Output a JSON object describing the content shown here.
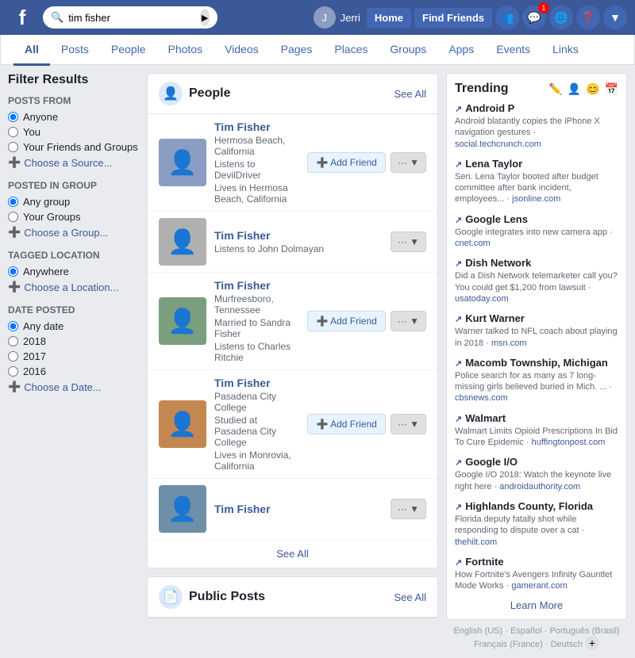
{
  "nav": {
    "logo": "f",
    "search_value": "tim fisher",
    "search_placeholder": "Search",
    "user_name": "Jerri",
    "notif_count": "1",
    "buttons": [
      "Home",
      "Find Friends"
    ],
    "icons": [
      "people-icon",
      "messages-icon",
      "globe-icon",
      "help-icon",
      "dropdown-icon"
    ]
  },
  "tabs": {
    "items": [
      {
        "label": "All",
        "active": true
      },
      {
        "label": "Posts",
        "active": false
      },
      {
        "label": "People",
        "active": false
      },
      {
        "label": "Photos",
        "active": false
      },
      {
        "label": "Videos",
        "active": false
      },
      {
        "label": "Pages",
        "active": false
      },
      {
        "label": "Places",
        "active": false
      },
      {
        "label": "Groups",
        "active": false
      },
      {
        "label": "Apps",
        "active": false
      },
      {
        "label": "Events",
        "active": false
      },
      {
        "label": "Links",
        "active": false
      }
    ]
  },
  "sidebar": {
    "title": "Filter Results",
    "posts_from": {
      "label": "POSTS FROM",
      "options": [
        "Anyone",
        "You",
        "Your Friends and Groups"
      ],
      "add_label": "Choose a Source..."
    },
    "posted_in_group": {
      "label": "POSTED IN GROUP",
      "options": [
        "Any group",
        "Your Groups"
      ],
      "add_label": "Choose a Group..."
    },
    "tagged_location": {
      "label": "TAGGED LOCATION",
      "options": [
        "Anywhere"
      ],
      "add_label": "Choose a Location..."
    },
    "date_posted": {
      "label": "DATE POSTED",
      "options": [
        "Any date",
        "2018",
        "2017",
        "2016"
      ],
      "add_label": "Choose a Date..."
    }
  },
  "people_section": {
    "title": "People",
    "see_all": "See All",
    "people": [
      {
        "name": "Tim Fisher",
        "details": [
          "Hermosa Beach, California",
          "Listens to DevilDriver",
          "Lives in Hermosa Beach, California"
        ],
        "has_add": true,
        "avatar_color": "#8b9dc3"
      },
      {
        "name": "Tim Fisher",
        "details": [
          "Listens to John Dolmayan"
        ],
        "has_add": false,
        "avatar_color": "#b0b0b0"
      },
      {
        "name": "Tim Fisher",
        "details": [
          "Murfreesboro, Tennessee",
          "Married to Sandra Fisher",
          "Listens to Charles Ritchie"
        ],
        "has_add": true,
        "avatar_color": "#7a9e7e"
      },
      {
        "name": "Tim Fisher",
        "details": [
          "Pasadena City College",
          "Studied at Pasadena City College",
          "Lives in Monrovia, California"
        ],
        "has_add": true,
        "avatar_color": "#c4874f"
      },
      {
        "name": "Tim Fisher",
        "details": [],
        "has_add": false,
        "avatar_color": "#6d8fa8"
      }
    ],
    "bottom_see_all": "See All",
    "add_friend_label": "Add Friend"
  },
  "public_posts": {
    "title": "Public Posts",
    "see_all": "See All"
  },
  "trending": {
    "title": "Trending",
    "items": [
      {
        "topic": "Android P",
        "desc": "Android blatantly copies the iPhone X navigation gestures",
        "source": "social.techcrunch.com"
      },
      {
        "topic": "Lena Taylor",
        "desc": "Sen. Lena Taylor booted after budget committee after bank incident, employees...",
        "source": "jsonline.com"
      },
      {
        "topic": "Google Lens",
        "desc": "Google integrates into new camera app",
        "source": "cnet.com"
      },
      {
        "topic": "Dish Network",
        "desc": "Did a Dish Network telemarketer call you? You could get $1,200 from lawsuit",
        "source": "usatoday.com"
      },
      {
        "topic": "Kurt Warner",
        "desc": "Warner talked to NFL coach about playing in 2018",
        "source": "msn.com"
      },
      {
        "topic": "Macomb Township, Michigan",
        "desc": "Police search for as many as 7 long-missing girls believed buried in Mich. ...",
        "source": "cbsnews.com"
      },
      {
        "topic": "Walmart",
        "desc": "Walmart Limits Opioid Prescriptions In Bid To Cure Epidemic",
        "source": "huffingtonpost.com"
      },
      {
        "topic": "Google I/O",
        "desc": "Google I/O 2018: Watch the keynote live right here",
        "source": "androidauthority.com"
      },
      {
        "topic": "Highlands County, Florida",
        "desc": "Florida deputy fatally shot while responding to dispute over a cat",
        "source": "thehilt.com"
      },
      {
        "topic": "Fortnite",
        "desc": "How Fortnite's Avengers Infinity Gauntlet Mode Works",
        "source": "gamerant.com"
      }
    ],
    "learn_more": "Learn More"
  },
  "footer": {
    "langs": [
      "English (US)",
      "Español",
      "Português (Brasil)",
      "Français (France)",
      "Deutsch"
    ]
  }
}
